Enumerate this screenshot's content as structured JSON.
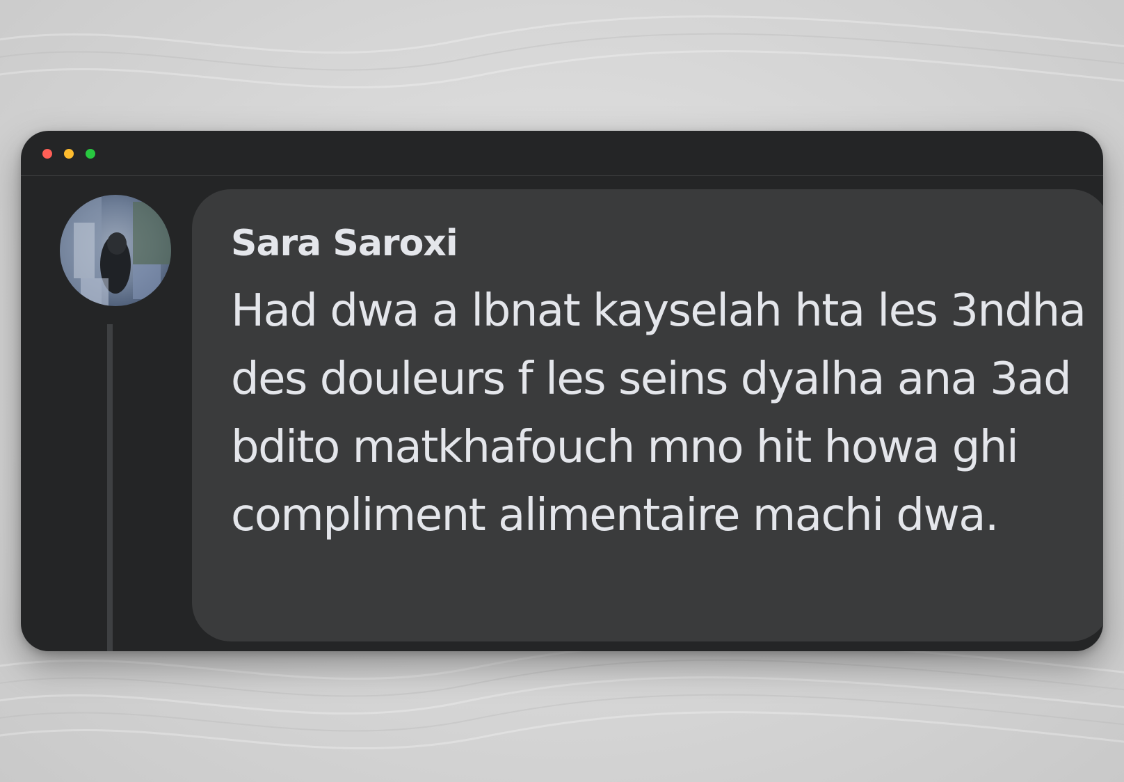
{
  "window": {
    "controls": [
      "close",
      "minimize",
      "maximize"
    ],
    "colors": {
      "close": "#ff5f57",
      "minimize": "#febc2e",
      "maximize": "#28c840",
      "window_bg": "#242526",
      "bubble_bg": "#3a3b3c",
      "text": "#e4e6eb"
    }
  },
  "comment": {
    "author": "Sara Saroxi",
    "text": "Had dwa a lbnat kayselah hta les 3ndha des douleurs f les seins dyalha ana 3ad bdito matkhafouch mno hit howa ghi compliment alimentaire machi dwa."
  }
}
